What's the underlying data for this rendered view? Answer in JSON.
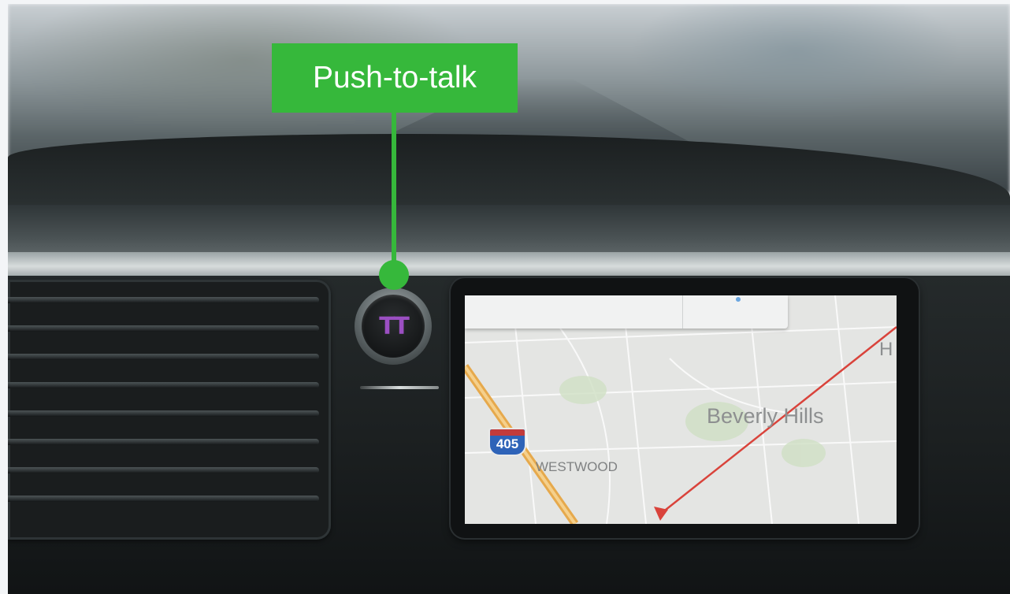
{
  "callout": {
    "label": "Push-to-talk",
    "color": "#36b83b"
  },
  "device": {
    "button_logo": "TT",
    "button_icon": "talkingtag-logo-icon",
    "logo_color": "#9b4fc2"
  },
  "map": {
    "labels": {
      "beverly_hills": "Beverly Hills",
      "westwood": "WESTWOOD",
      "edge_letter": "H"
    },
    "highway_shield": "405",
    "route_color": "#d9433b"
  }
}
